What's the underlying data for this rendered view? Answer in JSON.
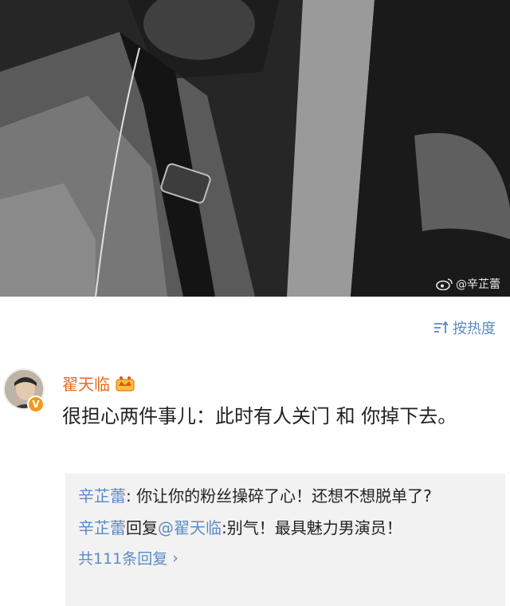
{
  "photo": {
    "watermark": "@辛芷蕾",
    "watermark_icon": "weibo-logo-icon"
  },
  "sort": {
    "label": "按热度",
    "icon": "sort-icon",
    "color": "#5b8bc5"
  },
  "comment": {
    "author": "翟天临",
    "author_color": "#e86b1a",
    "badges": [
      "crown-icon",
      "verified-v-icon"
    ],
    "text": "很担心两件事儿：此时有人关门 和 你掉下去。"
  },
  "replies": [
    {
      "author": "辛芷蕾",
      "separator": ": ",
      "text": "你让你的粉丝操碎了心！还想不想脱单了?"
    },
    {
      "author": "辛芷蕾",
      "action": "回复",
      "mention": "@翟天临",
      "separator": ":",
      "text": "别气！最具魅力男演员！"
    }
  ],
  "more_replies": {
    "label": "共111条回复",
    "chevron": "›"
  }
}
